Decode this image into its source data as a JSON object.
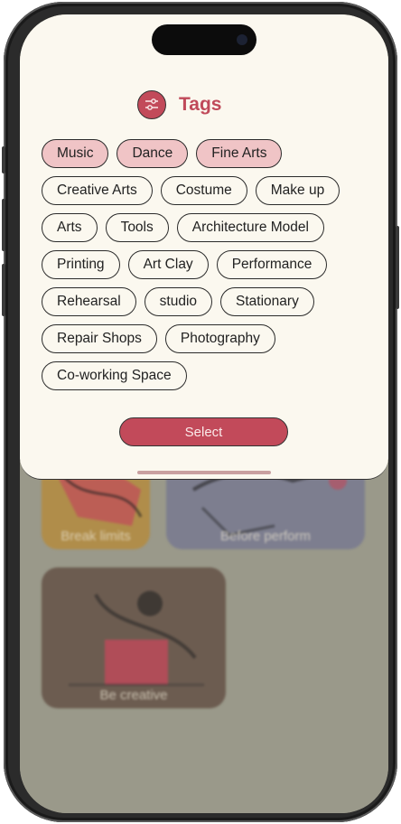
{
  "sheet": {
    "title": "Tags",
    "icon": "sliders-icon",
    "select_label": "Select"
  },
  "tags": [
    {
      "label": "Music",
      "selected": true
    },
    {
      "label": "Dance",
      "selected": true
    },
    {
      "label": "Fine Arts",
      "selected": true
    },
    {
      "label": "Creative Arts",
      "selected": false
    },
    {
      "label": "Costume",
      "selected": false
    },
    {
      "label": "Make up",
      "selected": false
    },
    {
      "label": "Arts",
      "selected": false
    },
    {
      "label": "Tools",
      "selected": false
    },
    {
      "label": "Architecture Model",
      "selected": false
    },
    {
      "label": "Printing",
      "selected": false
    },
    {
      "label": "Art Clay",
      "selected": false
    },
    {
      "label": "Performance",
      "selected": false
    },
    {
      "label": "Rehearsal",
      "selected": false
    },
    {
      "label": "studio",
      "selected": false
    },
    {
      "label": "Stationary",
      "selected": false
    },
    {
      "label": "Repair Shops",
      "selected": false
    },
    {
      "label": "Photography",
      "selected": false
    },
    {
      "label": "Co-working Space",
      "selected": false
    }
  ],
  "background_cards": [
    {
      "label": "Break limits"
    },
    {
      "label": "Before perform"
    },
    {
      "label": "Be creative"
    }
  ],
  "colors": {
    "accent": "#c24a5a",
    "selected_chip": "#f0c4c6",
    "sheet_bg": "#fbf8ef"
  }
}
